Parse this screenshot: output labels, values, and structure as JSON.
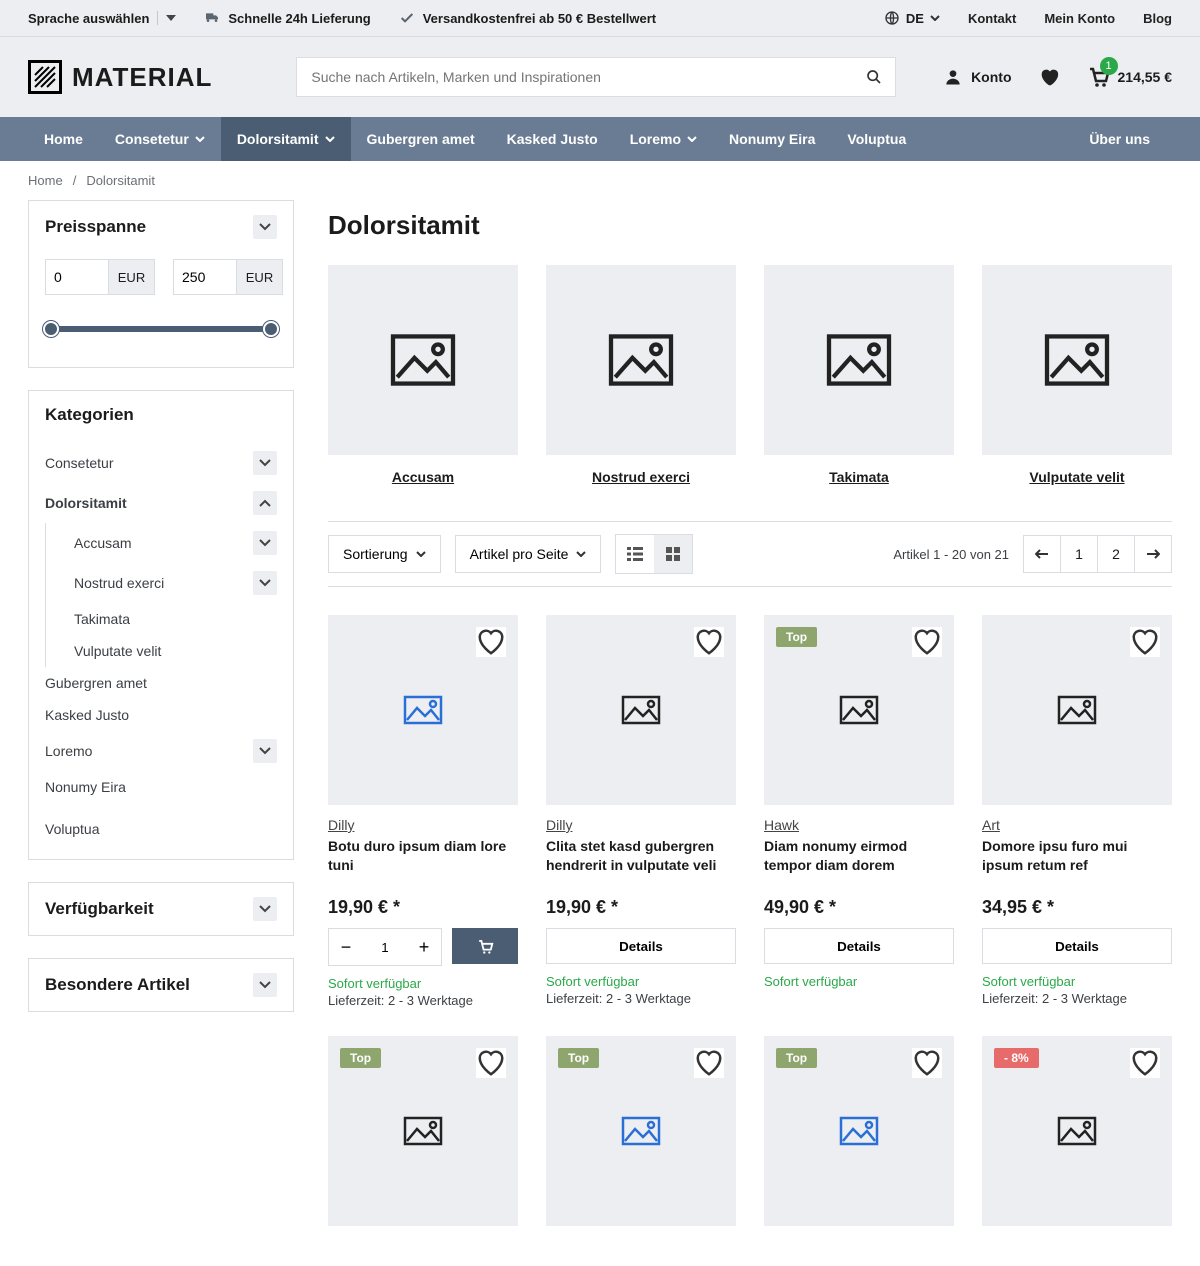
{
  "topbar": {
    "lang_label": "Sprache auswählen",
    "shipping": "Schnelle 24h Lieferung",
    "free_ship": "Versandkostenfrei ab 50 € Bestellwert",
    "locale": "DE",
    "contact": "Kontakt",
    "account": "Mein Konto",
    "blog": "Blog"
  },
  "header": {
    "logo": "MATERIAL",
    "search_placeholder": "Suche nach Artikeln, Marken und Inspirationen",
    "account_label": "Konto",
    "cart_qty": "1",
    "cart_total": "214,55 €"
  },
  "nav": {
    "items": [
      {
        "label": "Home"
      },
      {
        "label": "Consetetur",
        "dd": true
      },
      {
        "label": "Dolorsitamit",
        "dd": true,
        "active": true
      },
      {
        "label": "Gubergren amet"
      },
      {
        "label": "Kasked Justo"
      },
      {
        "label": "Loremo",
        "dd": true
      },
      {
        "label": "Nonumy Eira"
      },
      {
        "label": "Voluptua"
      }
    ],
    "about": "Über uns"
  },
  "crumbs": {
    "home": "Home",
    "current": "Dolorsitamit"
  },
  "sidebar": {
    "price_title": "Preisspanne",
    "price_min": "0",
    "price_max": "250",
    "cur": "EUR",
    "cat_title": "Kategorien",
    "cats": [
      {
        "label": "Consetetur",
        "chev": "down"
      },
      {
        "label": "Dolorsitamit",
        "chev": "up",
        "head": true
      },
      {
        "label": "Accusam",
        "sub": true,
        "chev": "down"
      },
      {
        "label": "Nostrud exerci",
        "sub": true,
        "chev": "down"
      },
      {
        "label": "Takimata",
        "sub": true
      },
      {
        "label": "Vulputate velit",
        "sub": true
      },
      {
        "label": "Gubergren amet"
      },
      {
        "label": "Kasked Justo"
      },
      {
        "label": "Loremo",
        "chev": "down"
      },
      {
        "label": "Nonumy Eira"
      },
      {
        "label": "Voluptua",
        "gap": true
      }
    ],
    "avail_title": "Verfügbarkeit",
    "special_title": "Besondere Artikel"
  },
  "page_title": "Dolorsitamit",
  "subcats": [
    "Accusam",
    "Nostrud exerci",
    "Takimata",
    "Vulputate velit"
  ],
  "toolbar": {
    "sort": "Sortierung",
    "per": "Artikel pro Seite",
    "count": "Artikel 1 - 20 von 21",
    "pages": [
      "1",
      "2"
    ]
  },
  "labels": {
    "details": "Details",
    "stock": "Sofort verfügbar",
    "ship": "Lieferzeit: 2 - 3 Werktage",
    "top": "Top"
  },
  "products_row1": [
    {
      "brand": "Dilly",
      "title": "Botu duro ipsum diam lore tuni",
      "price": "19,90 € *",
      "cart": true,
      "hl": true
    },
    {
      "brand": "Dilly",
      "title": "Clita stet kasd gubergren hendrerit in vulputate veli",
      "price": "19,90 € *"
    },
    {
      "brand": "Hawk",
      "title": "Diam nonumy eirmod tempor diam dorem",
      "price": "49,90 € *",
      "top": true,
      "no_ship": true
    },
    {
      "brand": "Art",
      "title": "Domore ipsu furo mui ipsum retum ref",
      "price": "34,95 € *"
    }
  ],
  "products_row2": [
    {
      "top": true
    },
    {
      "top": true,
      "hl": true
    },
    {
      "top": true,
      "hl": true
    },
    {
      "sale": "- 8%"
    }
  ]
}
